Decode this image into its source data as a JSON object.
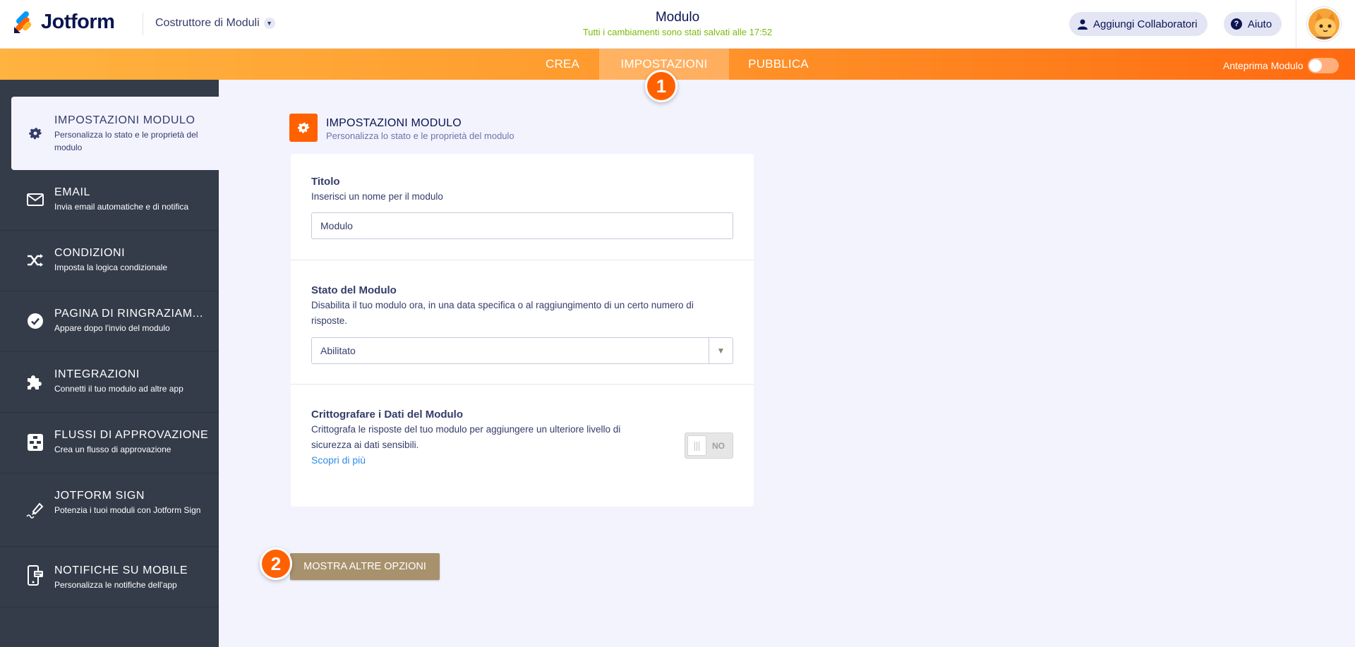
{
  "header": {
    "logo_text": "Jotform",
    "builder_label": "Costruttore di Moduli",
    "form_title": "Modulo",
    "save_status": "Tutti i cambiamenti sono stati salvati alle 17:52",
    "collaborators_label": "Aggiungi Collaboratori",
    "help_label": "Aiuto"
  },
  "nav": {
    "tabs": [
      {
        "label": "CREA",
        "active": false
      },
      {
        "label": "IMPOSTAZIONI",
        "active": true
      },
      {
        "label": "PUBBLICA",
        "active": false
      }
    ],
    "preview_label": "Anteprima Modulo"
  },
  "badges": {
    "one": "1",
    "two": "2"
  },
  "sidebar": {
    "items": [
      {
        "title": "IMPOSTAZIONI MODULO",
        "subtitle": "Personalizza lo stato e le proprietà del modulo",
        "icon": "gear-icon"
      },
      {
        "title": "EMAIL",
        "subtitle": "Invia email automatiche e di notifica",
        "icon": "envelope-icon"
      },
      {
        "title": "CONDIZIONI",
        "subtitle": "Imposta la logica condizionale",
        "icon": "shuffle-icon"
      },
      {
        "title": "PAGINA DI RINGRAZIAM...",
        "subtitle": "Appare dopo l'invio del modulo",
        "icon": "check-circle-icon"
      },
      {
        "title": "INTEGRAZIONI",
        "subtitle": "Connetti il tuo modulo ad altre app",
        "icon": "puzzle-icon"
      },
      {
        "title": "FLUSSI DI APPROVAZIONE",
        "subtitle": "Crea un flusso di approvazione",
        "icon": "flow-icon"
      },
      {
        "title": "JOTFORM SIGN",
        "subtitle": "Potenzia i tuoi moduli con Jotform Sign",
        "icon": "pen-icon"
      },
      {
        "title": "NOTIFICHE SU MOBILE",
        "subtitle": "Personalizza le notifiche dell'app",
        "icon": "mobile-icon"
      }
    ]
  },
  "main": {
    "section_title": "IMPOSTAZIONI MODULO",
    "section_subtitle": "Personalizza lo stato e le proprietà del modulo",
    "title_field": {
      "label": "Titolo",
      "description": "Inserisci un nome per il modulo",
      "value": "Modulo"
    },
    "status_field": {
      "label": "Stato del Modulo",
      "description": "Disabilita il tuo modulo ora, in una data specifica o al raggiungimento di un certo numero di risposte.",
      "value": "Abilitato"
    },
    "encrypt_field": {
      "label": "Crittografare i Dati del Modulo",
      "description": "Crittografa le risposte del tuo modulo per aggiungere un ulteriore livello di sicurezza ai dati sensibili.",
      "link": "Scopri di più",
      "toggle_label": "NO"
    },
    "more_options_label": "MOSTRA ALTRE OPZIONI"
  },
  "colors": {
    "accent": "#ff6100",
    "sidebar_bg": "#343c4a",
    "saved_green": "#78bb07",
    "more_button": "#a8916d"
  }
}
